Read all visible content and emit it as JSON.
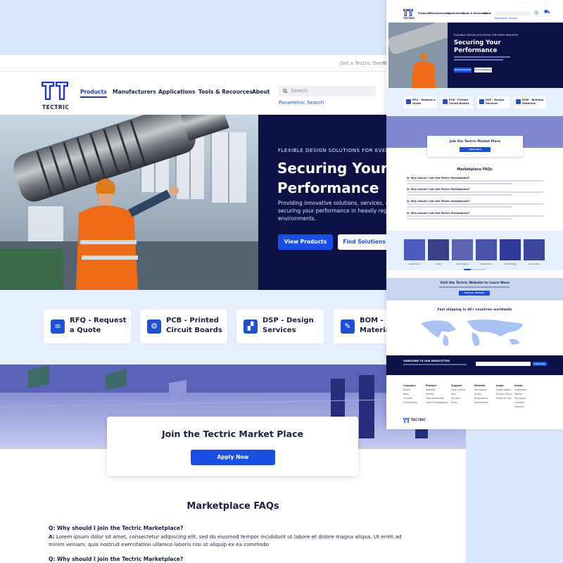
{
  "brand": {
    "name": "TECTRIC"
  },
  "topbar": {
    "demo_link": "Get a Tectric Demo",
    "more": "M"
  },
  "nav": {
    "items": [
      {
        "label": "Products",
        "active": true
      },
      {
        "label": "Manufacturers"
      },
      {
        "label": "Applications"
      },
      {
        "label": "Tools & Recources"
      },
      {
        "label": "About"
      }
    ],
    "search_placeholder": "Search",
    "parametric_search": "Parametric Search"
  },
  "hero": {
    "kicker": "FLEXIBLE DESIGN SOLUTIONS FOR EVERY IND",
    "title_line1": "Securing Your",
    "title_line2": "Performance",
    "desc_line1": "Providing innovative solutions, services, a",
    "desc_line2": "securing your performance in heavily reg",
    "desc_line3": "environments.",
    "primary_button": "View Products",
    "secondary_button": "Find Solutions"
  },
  "services": [
    {
      "label": "RFQ - Request a Quote",
      "icon": "rfq-list-icon"
    },
    {
      "label": "PCB - Printed Circuit Boards",
      "icon": "pcb-chip-icon"
    },
    {
      "label": "DSP - Design Services",
      "icon": "dsp-design-icon"
    },
    {
      "label": "BOM - B Materia",
      "icon": "bom-pen-icon"
    }
  ],
  "join": {
    "title": "Join the Tectric Market Place",
    "button": "Apply Now"
  },
  "faq": {
    "title": "Marketplace FAQs",
    "items": [
      {
        "q": "Q: Why should I join the Tectric Marketplace?",
        "a_label": "A:",
        "a_line1": " Lorem ipsum dolor sit amet, consectetur adipiscing elit, sed do eiusmod tempor incididunt ut labore et dolore magna aliqua. Ut enim ad",
        "a_line2": "minim veniam, quis nostrud exercitation ullamco laboris nisi ut aliquip ex ea commodo"
      },
      {
        "q": "Q: Why should I join the Tectric Marketplace?"
      }
    ]
  },
  "preview": {
    "hero_kicker": "FLEXIBLE DESIGN SOLUTIONS FOR EVERY INDUSTRY",
    "hero_title1": "Securing Your",
    "hero_title2": "Performance",
    "primary_button": "View Products",
    "secondary_button": "Find Solutions",
    "nav": [
      "Products",
      "Manufacturers",
      "Applications",
      "Tools & Recources",
      "About"
    ],
    "cards": [
      "RFQ - Request a Quote",
      "PCB - Printed Circuit Boards",
      "DSP - Design Services",
      "BOM - Building Materials"
    ],
    "join_title": "Join the Tectric Market Place",
    "join_button": "Apply Now",
    "faq_title": "Marketplace FAQs",
    "faq_q": "Q: Why should I join the Tectric Marketplace?",
    "applications": [
      "Aerospace",
      "Audio",
      "Automotive",
      "Automotive",
      "Computing",
      "Consumer"
    ],
    "visit_title": "Visit the Tectric Website to Learn More",
    "visit_button": "Visit our Website",
    "shipping_title": "Fast shipping to 40+ countries worldwide",
    "newsletter_label": "SUBSCRIBE TO OUR NEWSLETTER",
    "subscribe_button": "Subscribe",
    "footer_cols": [
      {
        "title": "Company",
        "links": [
          "About",
          "Blog",
          "Careers",
          "Community"
        ]
      },
      {
        "title": "Product",
        "links": [
          "Website",
          "Pricing",
          "Documentation",
          "Tools & Integration"
        ]
      },
      {
        "title": "Support",
        "links": [
          "Help Center",
          "FAQ",
          "Contact",
          "Press"
        ]
      },
      {
        "title": "Markets",
        "links": [
          "Aerospace",
          "Audio",
          "Automotive",
          "Automotive"
        ]
      },
      {
        "title": "Legal",
        "links": [
          "Legal Notice",
          "Privacy Policy",
          "Terms of Use"
        ]
      },
      {
        "title": "Social",
        "links": [
          "Instagram",
          "Twitter",
          "Facebook",
          "LinkedIn",
          "Youtube"
        ]
      }
    ],
    "footer_brand": "TECTRIC"
  },
  "colors": {
    "accent": "#1a4fe3",
    "navy": "#0e1146",
    "band": "#e6efff",
    "page_bg": "#d9e7fd"
  }
}
